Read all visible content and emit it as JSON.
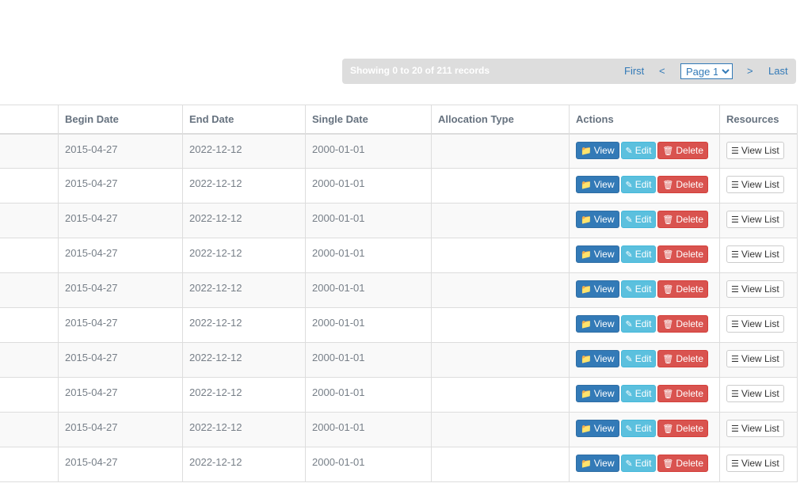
{
  "pager": {
    "info": "Showing 0 to 20 of 211 records",
    "first": "First",
    "prev": "<",
    "page": "Page 1",
    "next": ">",
    "last": "Last"
  },
  "columns": [
    "",
    "Begin Date",
    "End Date",
    "Single Date",
    "Allocation Type",
    "Actions",
    "Resources"
  ],
  "labels": {
    "view": "View",
    "edit": "Edit",
    "delete": "Delete",
    "view_list": "View List"
  },
  "rows": [
    {
      "begin": "2015-04-27",
      "end": "2022-12-12",
      "single": "2000-01-01",
      "alloc": ""
    },
    {
      "begin": "2015-04-27",
      "end": "2022-12-12",
      "single": "2000-01-01",
      "alloc": ""
    },
    {
      "begin": "2015-04-27",
      "end": "2022-12-12",
      "single": "2000-01-01",
      "alloc": ""
    },
    {
      "begin": "2015-04-27",
      "end": "2022-12-12",
      "single": "2000-01-01",
      "alloc": ""
    },
    {
      "begin": "2015-04-27",
      "end": "2022-12-12",
      "single": "2000-01-01",
      "alloc": ""
    },
    {
      "begin": "2015-04-27",
      "end": "2022-12-12",
      "single": "2000-01-01",
      "alloc": ""
    },
    {
      "begin": "2015-04-27",
      "end": "2022-12-12",
      "single": "2000-01-01",
      "alloc": ""
    },
    {
      "begin": "2015-04-27",
      "end": "2022-12-12",
      "single": "2000-01-01",
      "alloc": ""
    },
    {
      "begin": "2015-04-27",
      "end": "2022-12-12",
      "single": "2000-01-01",
      "alloc": ""
    },
    {
      "begin": "2015-04-27",
      "end": "2022-12-12",
      "single": "2000-01-01",
      "alloc": ""
    }
  ],
  "icons": {
    "view": "folder-icon",
    "edit": "pencil-icon",
    "delete": "trash-icon",
    "list": "list-icon"
  }
}
